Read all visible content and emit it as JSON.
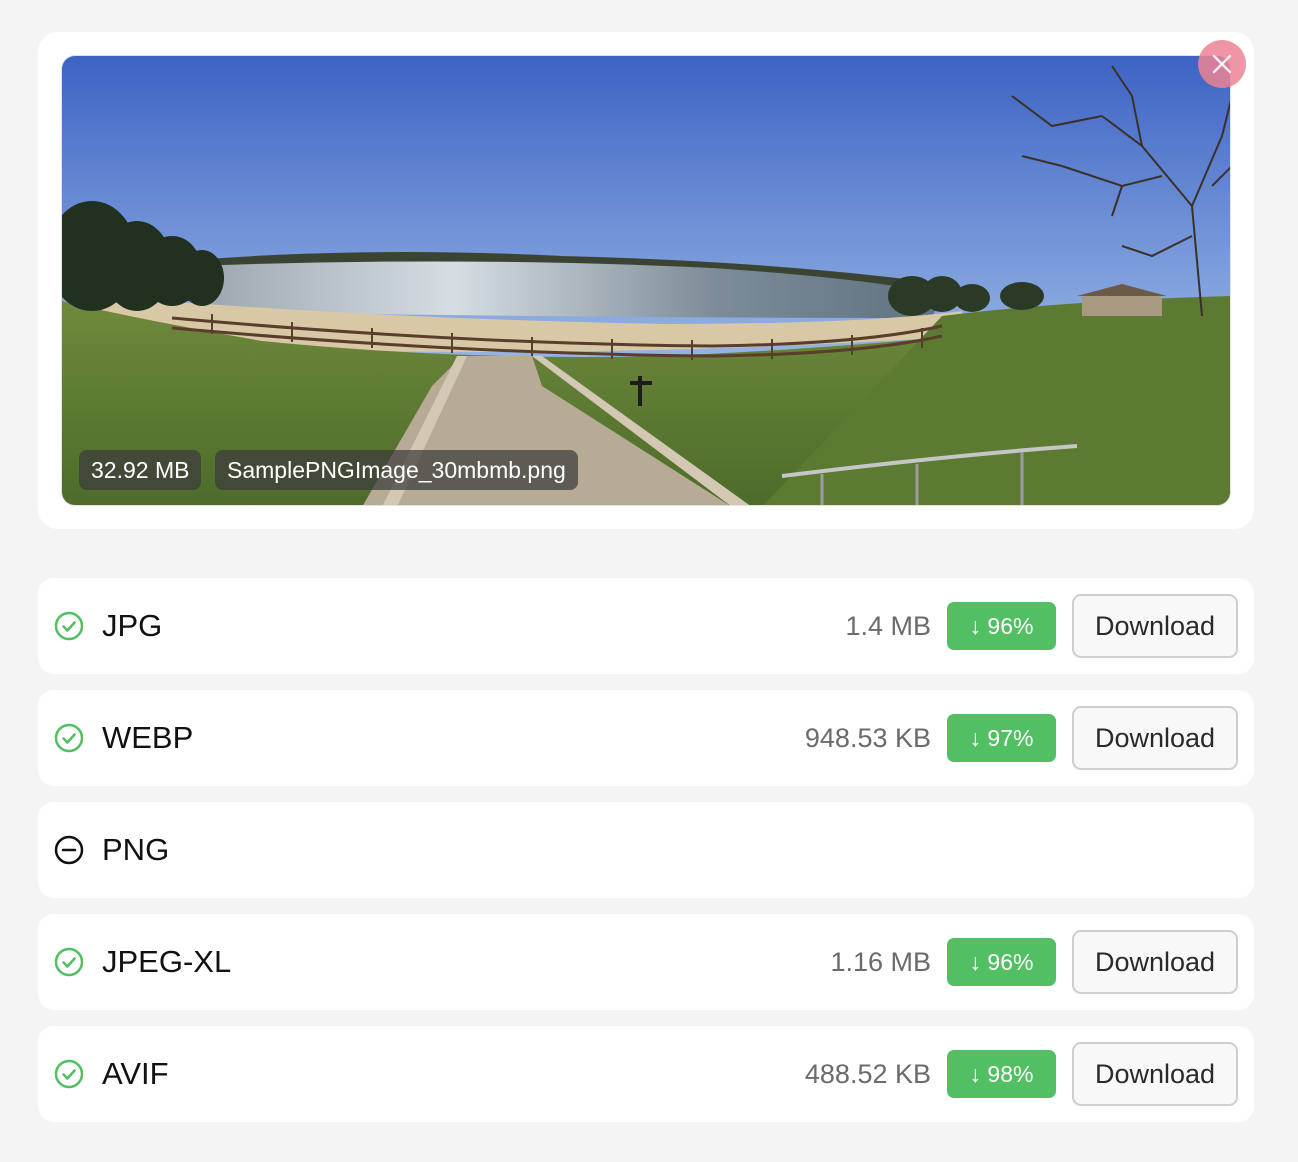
{
  "preview": {
    "file_size": "32.92 MB",
    "file_name": "SamplePNGImage_30mbmb.png",
    "close_icon": "close-icon",
    "image_alt": "Panoramic photo of a lake beach with a path, fence and trees"
  },
  "conversions": [
    {
      "format": "JPG",
      "status_icon": "check-circle-icon",
      "size": "1.4 MB",
      "saving": "↓ 96%",
      "download_label": "Download"
    },
    {
      "format": "WEBP",
      "status_icon": "check-circle-icon",
      "size": "948.53 KB",
      "saving": "↓ 97%",
      "download_label": "Download"
    },
    {
      "format": "PNG",
      "status_icon": "minus-circle-icon"
    },
    {
      "format": "JPEG-XL",
      "status_icon": "check-circle-icon",
      "size": "1.16 MB",
      "saving": "↓ 96%",
      "download_label": "Download"
    },
    {
      "format": "AVIF",
      "status_icon": "check-circle-icon",
      "size": "488.52 KB",
      "saving": "↓ 98%",
      "download_label": "Download"
    }
  ],
  "colors": {
    "success": "#53bf63",
    "close_button": "#ec8294",
    "background": "#f4f4f4"
  }
}
